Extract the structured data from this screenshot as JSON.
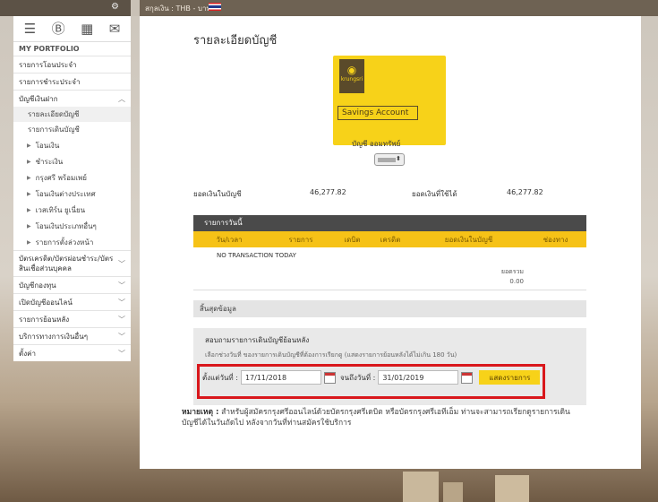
{
  "header": {
    "currency": "สกุลเงิน : THB - บาท"
  },
  "sidebar": {
    "icons": [
      "menu-icon",
      "currency-exchange-icon",
      "calculator-icon",
      "mail-icon"
    ],
    "section_header": "MY PORTFOLIO",
    "items": [
      {
        "label": "รายการโอนประจำ"
      },
      {
        "label": "รายการชำระประจำ"
      },
      {
        "label": "บัญชีเงินฝาก"
      }
    ],
    "deposit_sub": [
      {
        "label": "รายละเอียดบัญชี"
      },
      {
        "label": "รายการเดินบัญชี"
      }
    ],
    "tree": [
      {
        "label": "โอนเงิน"
      },
      {
        "label": "ชำระเงิน"
      },
      {
        "label": "กรุงศรี พร้อมเพย์"
      },
      {
        "label": "โอนเงินต่างประเทศ"
      },
      {
        "label": "เวสเทิร์น ยูเนี่ยน"
      },
      {
        "label": "โอนเงินประเภทอื่นๆ"
      },
      {
        "label": "รายการตั้งล่วงหน้า"
      }
    ],
    "bottom": [
      {
        "label": "บัตรเครดิต/บัตรผ่อนชำระ/บัตรสินเชื่อส่วนบุคคล"
      },
      {
        "label": "บัญชีกองทุน"
      },
      {
        "label": "เปิดบัญชีออนไลน์"
      },
      {
        "label": "รายการย้อนหลัง"
      },
      {
        "label": "บริการทางการเงินอื่นๆ"
      },
      {
        "label": "ตั้งค่า"
      }
    ]
  },
  "main": {
    "title": "รายละเอียดบัญชี",
    "card": {
      "brand": "krungsri",
      "label": "Savings Account"
    },
    "account_name": "บัญชี ออมทรัพย์",
    "balance_label": "ยอดเงินในบัญชี",
    "balance_value": "46,277.82",
    "available_label": "ยอดเงินที่ใช้ได้",
    "available_value": "46,277.82",
    "today": {
      "title": "รายการวันนี้",
      "columns": [
        "วัน/เวลา",
        "รายการ",
        "เดบิต",
        "เครดิต",
        "ยอดเงินในบัญชี",
        "ช่องทาง"
      ],
      "empty": "NO TRANSACTION TODAY",
      "total_label": "ยอดรวม",
      "total_value": "0.00",
      "end": "สิ้นสุดข้อมูล"
    },
    "history": {
      "title": "สอบถามรายการเดินบัญชีย้อนหลัง",
      "subtitle": "เลือกช่วงวันที่ ของรายการเดินบัญชีที่ต้องการเรียกดู (แสดงรายการย้อนหลังได้ไม่เกิน 180 วัน)",
      "from_label": "ตั้งแต่วันที่ :",
      "from_value": "17/11/2018",
      "to_label": "จนถึงวันที่ :",
      "to_value": "31/01/2019",
      "button": "แสดงรายการ"
    },
    "note_label": "หมายเหตุ :",
    "note_text": "สำหรับผู้สมัครกรุงศรีออนไลน์ด้วยบัตรกรุงศรีเดบิต หรือบัตรกรุงศรีเอทีเอ็ม ท่านจะสามารถเรียกดูรายการเดินบัญชีได้ในวันถัดไป หลังจากวันที่ท่านสมัครใช้บริการ"
  },
  "colors": {
    "accent": "#f7d219",
    "highlight": "#d9171c",
    "table_header": "#4a4a4a"
  }
}
